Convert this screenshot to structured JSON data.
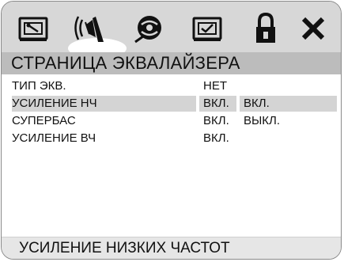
{
  "tabs": [
    {
      "icon": "settings-tab-icon",
      "active": false
    },
    {
      "icon": "audio-speaker-icon",
      "active": true
    },
    {
      "icon": "disc-icon",
      "active": false
    },
    {
      "icon": "video-screen-icon",
      "active": false
    },
    {
      "icon": "lock-icon",
      "active": false
    },
    {
      "icon": "close-icon",
      "active": false
    }
  ],
  "page_title": "СТРАНИЦА ЭКВАЛАЙЗЕРА",
  "rows": [
    {
      "label": "ТИП ЭКВ.",
      "value": "НЕТ",
      "option": ""
    },
    {
      "label": "УСИЛЕНИЕ НЧ",
      "value": "ВКЛ.",
      "option": "ВКЛ."
    },
    {
      "label": "СУПЕРБАС",
      "value": "ВКЛ.",
      "option": "ВЫКЛ."
    },
    {
      "label": "УСИЛЕНИЕ ВЧ",
      "value": "ВКЛ.",
      "option": ""
    }
  ],
  "status_text": "УСИЛЕНИЕ НИЗКИХ ЧАСТОТ"
}
